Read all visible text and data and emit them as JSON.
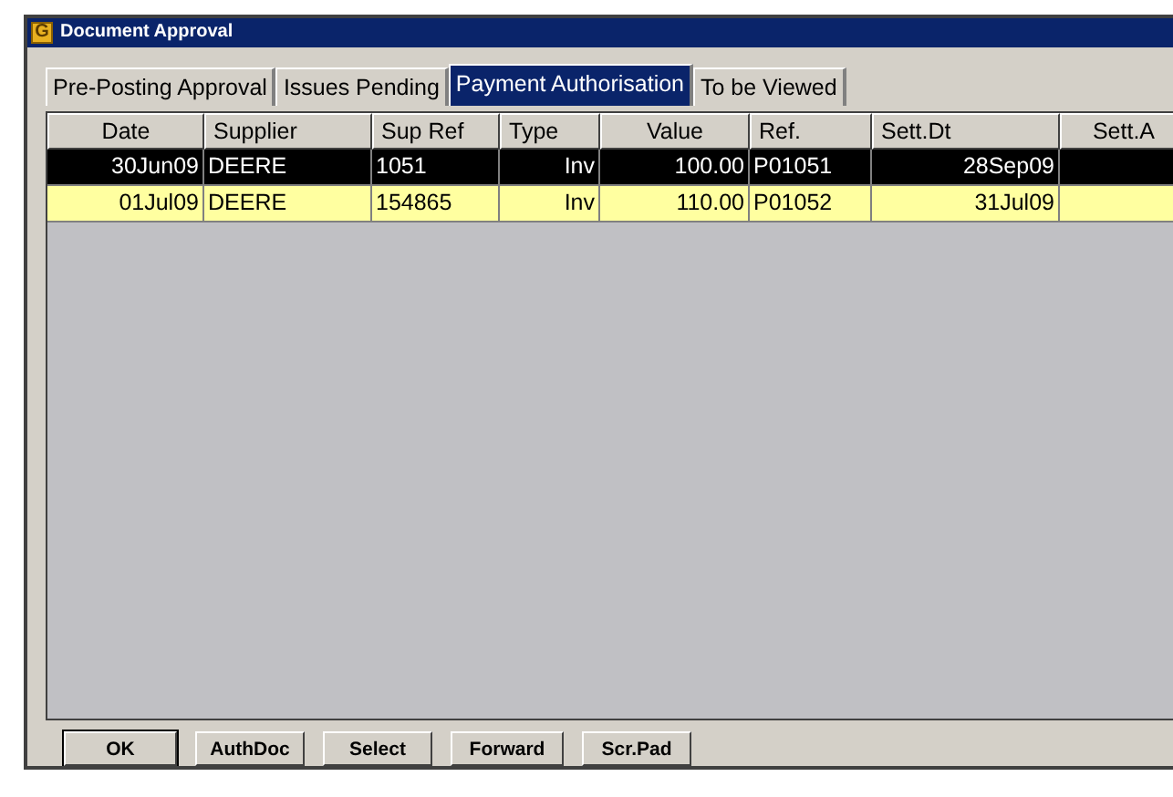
{
  "window": {
    "title": "Document Approval",
    "icon": "G"
  },
  "tabs": [
    {
      "label": "Pre-Posting Approval",
      "selected": false
    },
    {
      "label": "Issues Pending",
      "selected": false
    },
    {
      "label": "Payment Authorisation",
      "selected": true
    },
    {
      "label": "To be Viewed",
      "selected": false
    }
  ],
  "table": {
    "columns": [
      "Date",
      "Supplier",
      "Sup Ref",
      "Type",
      "Value",
      "Ref.",
      "Sett.Dt",
      "Sett.A"
    ],
    "rows": [
      {
        "selected": true,
        "cells": [
          "30Jun09",
          "DEERE",
          "1051",
          "Inv",
          "100.00",
          "P01051",
          "28Sep09",
          ""
        ]
      },
      {
        "selected": false,
        "cells": [
          "01Jul09",
          "DEERE",
          "154865",
          "Inv",
          "110.00",
          "P01052",
          "31Jul09",
          ""
        ]
      }
    ]
  },
  "buttons": [
    "OK",
    "AuthDoc",
    "Select",
    "Forward",
    "Scr.Pad"
  ]
}
